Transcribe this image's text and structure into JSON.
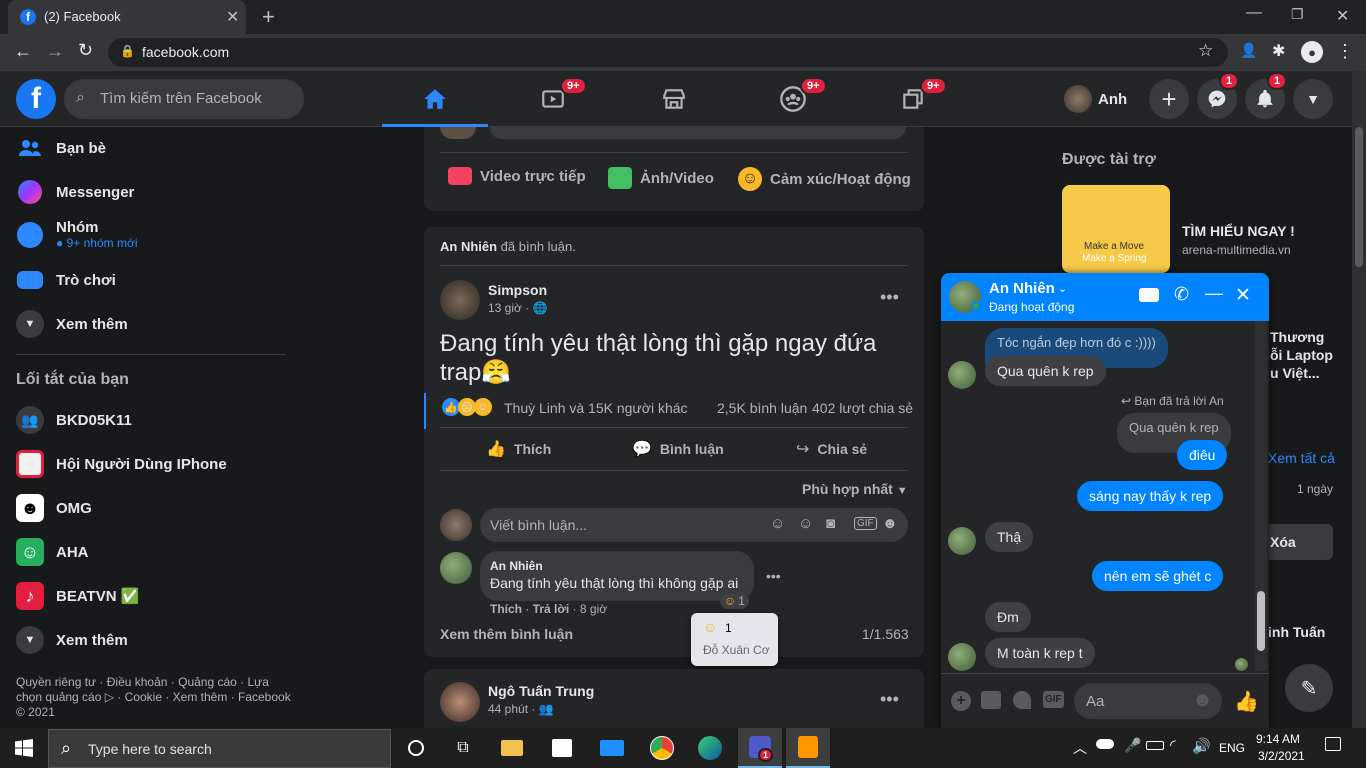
{
  "browser": {
    "tab_title": "(2) Facebook",
    "url": "facebook.com"
  },
  "header": {
    "search_placeholder": "Tìm kiếm trên Facebook",
    "badges": {
      "watch": "9+",
      "groups": "9+",
      "gaming": "9+",
      "messenger": "1",
      "notifications": "1"
    },
    "profile_name": "Anh"
  },
  "left_nav": {
    "items": [
      {
        "label": "Bạn bè"
      },
      {
        "label": "Messenger"
      },
      {
        "label": "Nhóm",
        "sub": "● 9+ nhóm mới"
      },
      {
        "label": "Trò chơi"
      },
      {
        "label": "Xem thêm"
      }
    ],
    "shortcuts_title": "Lối tắt của bạn",
    "shortcuts": [
      {
        "label": "BKD05K11"
      },
      {
        "label": "Hội Người Dùng IPhone"
      },
      {
        "label": "OMG"
      },
      {
        "label": "AHA"
      },
      {
        "label": "BEATVN ✅"
      },
      {
        "label": "Xem thêm"
      }
    ],
    "footer": "Quyền riêng tư · Điều khoản · Quảng cáo · Lựa chọn quảng cáo ▷ · Cookie · Xem thêm · Facebook © 2021"
  },
  "composer": {
    "live": "Video trực tiếp",
    "photo": "Ảnh/Video",
    "feeling": "Cảm xúc/Hoạt động"
  },
  "post": {
    "activity_name": "An Nhiên",
    "activity_text": " đã bình luận.",
    "author": "Simpson",
    "time": "13 giờ · 🌐",
    "text": "Đang tính yêu thật lòng thì gặp ngay đứa trap😤",
    "reactions_text": "Thuỳ Linh và 15K người khác",
    "comments_count": "2,5K bình luận",
    "shares_count": "402 lượt chia sẻ",
    "like": "Thích",
    "comment": "Bình luận",
    "share": "Chia sẻ",
    "sort": "Phù hợp nhất",
    "comment_placeholder": "Viết bình luận...",
    "comment_author": "An Nhiên",
    "comment_text": "Đang tính yêu thật lòng thì không gặp ai",
    "comment_like": "Thích",
    "comment_reply": "Trả lời",
    "comment_time": "8 giờ",
    "comment_reaction_count": "1",
    "tooltip_count": "1",
    "tooltip_name": "Đỗ Xuân Cơ",
    "more_comments": "Xem thêm bình luận",
    "comment_pager": "1/1.563"
  },
  "post2": {
    "author": "Ngô Tuấn Trung",
    "time": "44 phút · 👥"
  },
  "right": {
    "sponsored": "Được tài trợ",
    "ad_title": "TÌM HIỂU NGAY !",
    "ad_domain": "arena-multimedia.vn",
    "ad_img_line1": "Make a Move",
    "ad_img_line2": "Make a Spring",
    "ad2_line1": "Thương",
    "ad2_line2": "ỗi Laptop",
    "ad2_line3": "u Việt...",
    "see_all": "Xem tất cả",
    "one_day": "1 ngày",
    "delete": "Xóa",
    "contact": "inh Tuấn"
  },
  "chat": {
    "name": "An Nhiên",
    "status": "Đang hoạt động",
    "messages": {
      "quoted": "Tóc ngắn đẹp hơn đó c :))))",
      "m1": "Qua quên k rep",
      "reply_note": "Bạn đã trả lời An",
      "reply_quoted": "Qua quên k rep",
      "m2": "điêu",
      "m3": "sáng nay thấy k rep",
      "m4": "Thậ",
      "m5": "nên em sẽ ghét c",
      "m6": "Đm",
      "m7": "M toàn k rep t"
    },
    "input_placeholder": "Aa"
  },
  "taskbar": {
    "search_placeholder": "Type here to search",
    "lang": "ENG",
    "time": "9:14 AM",
    "date": "3/2/2021",
    "teams_badge": "1"
  }
}
